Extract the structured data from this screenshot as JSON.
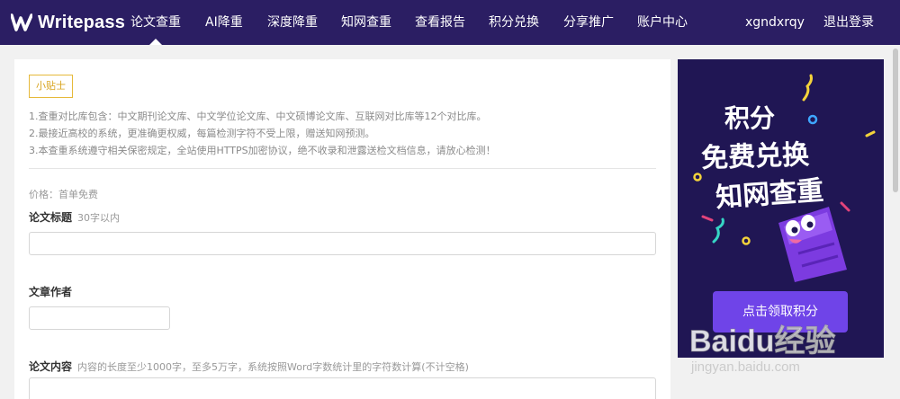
{
  "brand": {
    "name": "Writepass"
  },
  "nav": {
    "items": [
      {
        "label": "论文查重",
        "active": true
      },
      {
        "label": "AI降重"
      },
      {
        "label": "深度降重"
      },
      {
        "label": "知网查重"
      },
      {
        "label": "查看报告"
      },
      {
        "label": "积分兑换"
      },
      {
        "label": "分享推广"
      },
      {
        "label": "账户中心"
      }
    ],
    "username": "xgndxrqy",
    "logout": "退出登录"
  },
  "tips": {
    "badge": "小贴士",
    "lines": [
      "1.查重对比库包含：中文期刊论文库、中文学位论文库、中文硕博论文库、互联网对比库等12个对比库。",
      "2.最接近高校的系统，更准确更权威，每篇检测字符不受上限，赠送知网预测。",
      "3.本查重系统遵守相关保密规定，全站使用HTTPS加密协议，绝不收录和泄露送检文档信息，请放心检测！"
    ]
  },
  "price": "价格：首单免费",
  "form": {
    "title": {
      "label": "论文标题",
      "hint": "30字以内",
      "value": ""
    },
    "author": {
      "label": "文章作者",
      "value": ""
    },
    "content": {
      "label": "论文内容",
      "hint": "内容的长度至少1000字，至多5万字，系统按照Word字数统计里的字符数计算(不计空格)",
      "value": ""
    }
  },
  "ad": {
    "line1": "积分",
    "line2": "免费兑换",
    "line3": "知网查重",
    "button": "点击领取积分"
  },
  "watermark": {
    "brand": "Baidu经验",
    "url": "jingyan.baidu.com"
  },
  "colors": {
    "nav_bg": "#2b1e63",
    "ad_bg": "#201654",
    "accent": "#6f44e8",
    "tip": "#e6b93a"
  }
}
